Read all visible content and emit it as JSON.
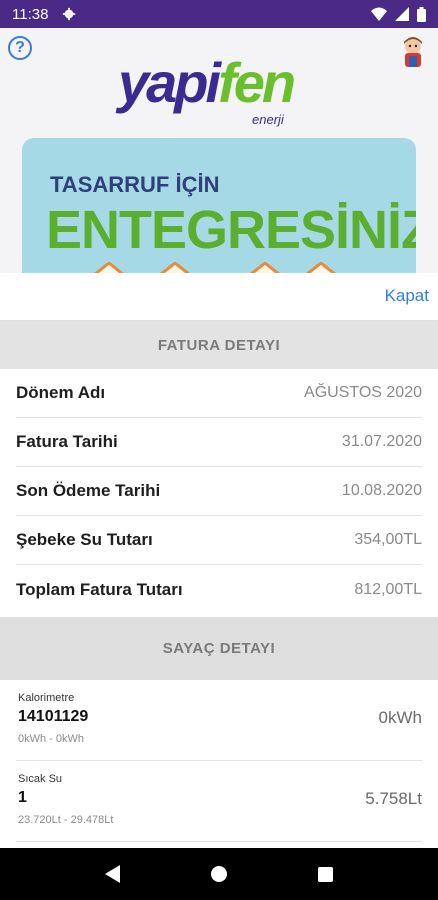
{
  "status_bar": {
    "time": "11:38"
  },
  "header": {
    "logo_text_part1": "yapi",
    "logo_text_part2": "fen",
    "logo_subtext": "enerji",
    "help_icon_glyph": "?"
  },
  "banner": {
    "line1": "TASARRUF İÇİN",
    "line2": "ENTEGRESİNİZ!"
  },
  "sheet": {
    "close_label": "Kapat"
  },
  "invoice": {
    "header": "FATURA DETAYI",
    "rows": [
      {
        "label": "Dönem Adı",
        "value": "AĞUSTOS 2020"
      },
      {
        "label": "Fatura Tarihi",
        "value": "31.07.2020"
      },
      {
        "label": "Son Ödeme Tarihi",
        "value": "10.08.2020"
      },
      {
        "label": "Şebeke Su Tutarı",
        "value": "354,00TL"
      },
      {
        "label": "Toplam Fatura Tutarı",
        "value": "812,00TL"
      }
    ]
  },
  "meters": {
    "header": "SAYAÇ DETAYI",
    "rows": [
      {
        "type": "Kalorimetre",
        "id": "14101129",
        "range": "0kWh - 0kWh",
        "reading": "0kWh"
      },
      {
        "type": "Sıcak Su",
        "id": "1",
        "range": "23.720Lt - 29.478Lt",
        "reading": "5.758Lt"
      }
    ]
  },
  "colors": {
    "status_bar": "#4a2a86",
    "brand_purple": "#3b2a8f",
    "brand_green": "#6bbf2c",
    "link_blue": "#2f7fe0",
    "section_header_bg": "#e3e3e3"
  },
  "icons": {
    "status": [
      "settings-gear-icon",
      "wifi-icon",
      "signal-icon",
      "battery-icon"
    ],
    "header": [
      "help-icon",
      "mascot-icon"
    ],
    "nav": [
      "back-icon",
      "home-icon",
      "recents-icon"
    ]
  }
}
